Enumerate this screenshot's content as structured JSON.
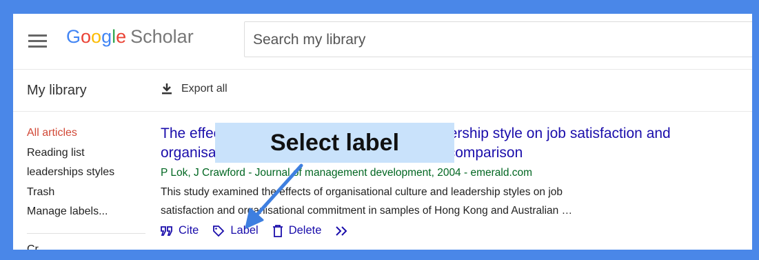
{
  "logo": {
    "google_letters": [
      "G",
      "o",
      "o",
      "g",
      "l",
      "e"
    ],
    "scholar": "Scholar"
  },
  "search": {
    "placeholder": "Search my library"
  },
  "subbar": {
    "my_library": "My library",
    "export_all": "Export all"
  },
  "sidebar": {
    "items": [
      {
        "label": "All articles",
        "active": true
      },
      {
        "label": "Reading list"
      },
      {
        "label": "leaderships styles"
      },
      {
        "label": "Trash"
      },
      {
        "label": "Manage labels..."
      }
    ],
    "cut_item": "Cr..."
  },
  "result": {
    "title_line1": "The effects of organisational culture and leadership style on job satisfaction and",
    "title_line2": "organisational commitment: A cross‐national comparison",
    "authors": "P Lok, J Crawford - Journal of management development, 2004 - emerald.com",
    "snippet_line1": "This study examined the effects of organisational culture and leadership styles on job",
    "snippet_line2": "satisfaction and organisational commitment in samples of Hong Kong and Australian …",
    "actions": {
      "cite": "Cite",
      "label": "Label",
      "delete": "Delete"
    }
  },
  "callout": {
    "text": "Select label"
  },
  "colors": {
    "frame": "#4a87e8",
    "callout_bg": "#c9e2fb",
    "link": "#1a0dab",
    "active": "#d14836",
    "arrow": "#3e7fe0"
  },
  "icons": [
    "menu-icon",
    "download-icon",
    "quote-icon",
    "tag-icon",
    "trash-icon",
    "double-chevron-icon"
  ]
}
